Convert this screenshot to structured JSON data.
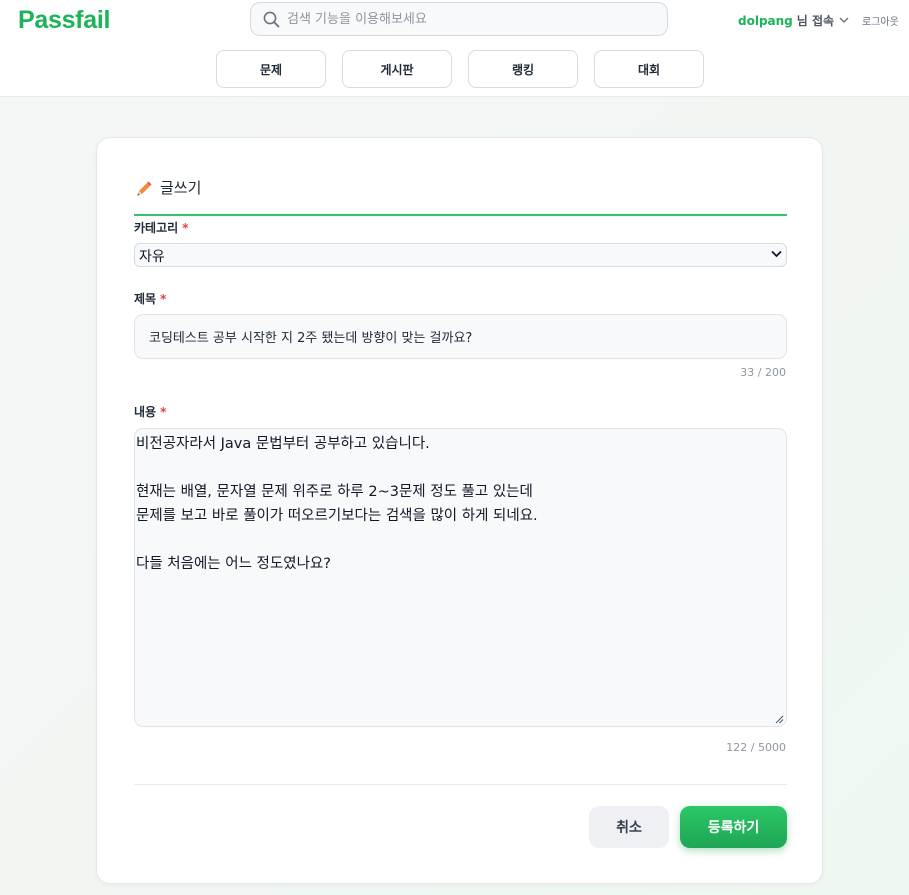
{
  "header": {
    "logo": "Passfail",
    "search": {
      "placeholder": "검색 기능을 이용해보세요",
      "value": ""
    },
    "user": {
      "name": "dolpang",
      "suffix": "님 접속"
    },
    "logout_label": "로그아웃"
  },
  "nav": {
    "items": [
      {
        "label": "문제"
      },
      {
        "label": "게시판"
      },
      {
        "label": "랭킹"
      },
      {
        "label": "대회"
      }
    ]
  },
  "form": {
    "title": "글쓰기",
    "category": {
      "label": "카테고리",
      "required_mark": "*",
      "value": "자유"
    },
    "title_field": {
      "label": "제목",
      "required_mark": "*",
      "value": "코딩테스트 공부 시작한 지 2주 됐는데 방향이 맞는 걸까요?",
      "counter": "33 / 200"
    },
    "content_field": {
      "label": "내용",
      "required_mark": "*",
      "value": "비전공자라서 Java 문법부터 공부하고 있습니다.\n\n현재는 배열, 문자열 문제 위주로 하루 2~3문제 정도 풀고 있는데\n문제를 보고 바로 풀이가 떠오르기보다는 검색을 많이 하게 되네요.\n\n다들 처음에는 어느 정도였나요?",
      "counter": "122 / 5000"
    },
    "cancel_label": "취소",
    "submit_label": "등록하기"
  },
  "colors": {
    "brand": "#1db35a",
    "required": "#e53e3e",
    "submit_button": "#22b85e"
  },
  "icons": {
    "search": "search-icon",
    "chevron": "chevron-down-icon",
    "pencil": "pencil-icon",
    "resize": "resize-grip-icon"
  }
}
